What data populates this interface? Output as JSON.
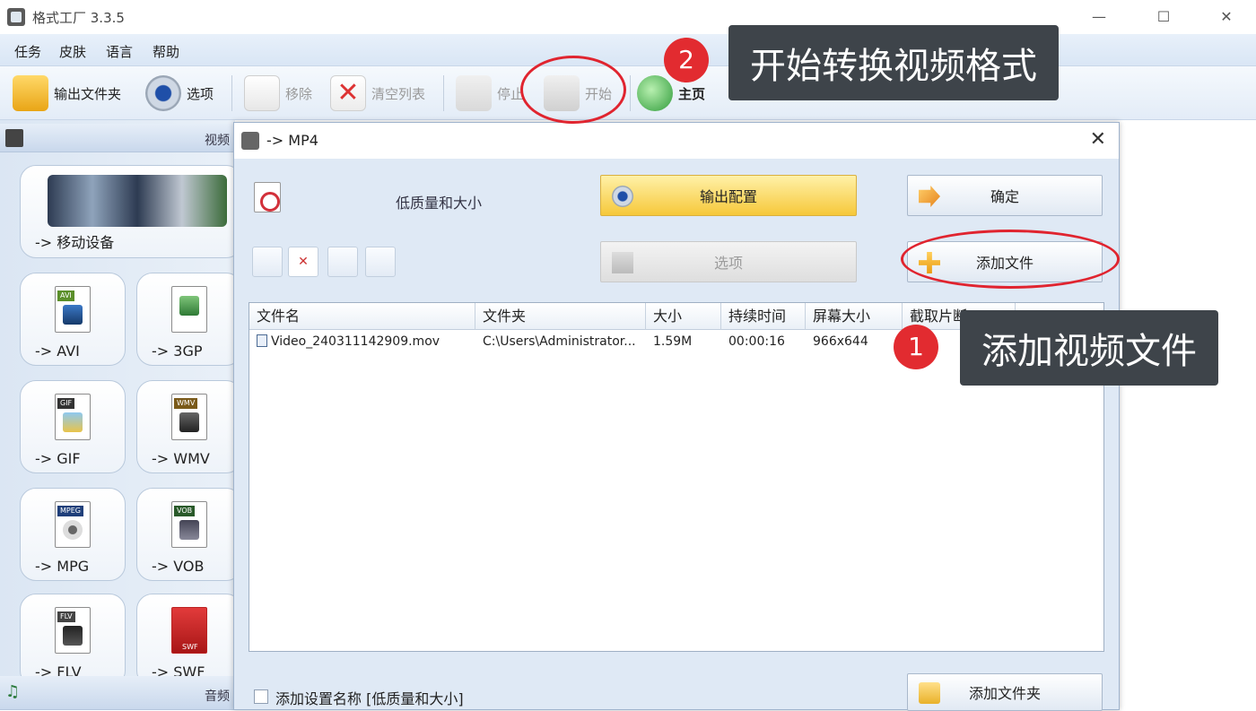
{
  "window": {
    "title": "格式工厂 3.3.5",
    "minimize": "—",
    "maximize": "☐",
    "close": "✕"
  },
  "menu": [
    "任务",
    "皮肤",
    "语言",
    "帮助"
  ],
  "toolbar": {
    "output_folder": "输出文件夹",
    "options": "选项",
    "remove": "移除",
    "clear_list": "清空列表",
    "stop": "停止",
    "start": "开始",
    "home": "主页"
  },
  "left_panel": {
    "video_header": "视频",
    "audio_header": "音频",
    "formats": {
      "mobile": "-> 移动设备",
      "avi": "-> AVI",
      "3gp": "-> 3GP",
      "gif": "-> GIF",
      "wmv": "-> WMV",
      "mpg": "-> MPG",
      "vob": "-> VOB",
      "flv": "-> FLV",
      "swf": "-> SWF"
    },
    "tags": {
      "avi": "AVI",
      "gif": "GIF",
      "wmv": "WMV",
      "mpg": "MPEG",
      "vob": "VOB",
      "flv": "FLV",
      "swf": "SWF"
    }
  },
  "dialog": {
    "title": "-> MP4",
    "close": "✕",
    "quality_label": "低质量和大小",
    "output_config": "输出配置",
    "confirm": "确定",
    "options": "选项",
    "add_file": "添加文件",
    "add_folder": "添加文件夹",
    "add_setting_name": "添加设置名称 [低质量和大小]",
    "table": {
      "headers": [
        "文件名",
        "文件夹",
        "大小",
        "持续时间",
        "屏幕大小",
        "截取片断"
      ],
      "rows": [
        {
          "name": "Video_240311142909.mov",
          "folder": "C:\\Users\\Administrator...",
          "size": "1.59M",
          "duration": "00:00:16",
          "screen": "966x644",
          "clip": ""
        }
      ]
    }
  },
  "annotations": {
    "step1_number": "1",
    "step1_text": "添加视频文件",
    "step2_number": "2",
    "step2_text": "开始转换视频格式",
    "ring_color": "#e0242f",
    "callout_bg": "#3e444a"
  }
}
